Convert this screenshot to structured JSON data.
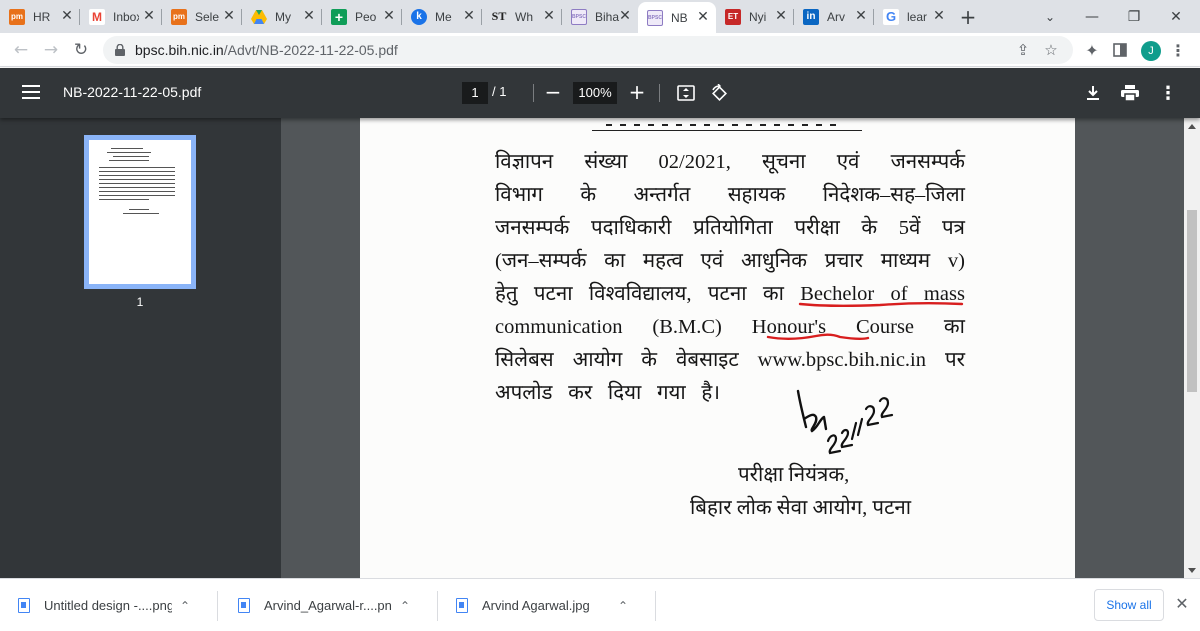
{
  "tabs": [
    {
      "title": "HR",
      "favicon": "pm-icon",
      "favicon_text": "pm",
      "color": "#e8711a"
    },
    {
      "title": "Inbox",
      "favicon": "gmail-icon",
      "favicon_text": "M",
      "color": "#ea4335"
    },
    {
      "title": "Sele",
      "favicon": "pm-icon",
      "favicon_text": "pm",
      "color": "#e8711a"
    },
    {
      "title": "My",
      "favicon": "drive-icon",
      "favicon_text": "▲",
      "color": "#1fa463"
    },
    {
      "title": "Peo",
      "favicon": "sheets-plus-icon",
      "favicon_text": "+",
      "color": "#0f9d58"
    },
    {
      "title": "Me",
      "favicon": "k-icon",
      "favicon_text": "k",
      "color": "#1a73e8"
    },
    {
      "title": "Wh",
      "favicon": "st-icon",
      "favicon_text": "ST",
      "color": "#222222"
    },
    {
      "title": "Biha",
      "favicon": "bpsc-icon",
      "favicon_text": "BPSC",
      "color": "#8e7cc3"
    },
    {
      "title": "NB",
      "favicon": "bpsc-icon",
      "favicon_text": "BPSC",
      "color": "#8e7cc3",
      "active": true
    },
    {
      "title": "Nyi",
      "favicon": "et-icon",
      "favicon_text": "ET",
      "color": "#c62828"
    },
    {
      "title": "Arv",
      "favicon": "linkedin-icon",
      "favicon_text": "in",
      "color": "#0a66c2"
    },
    {
      "title": "lear",
      "favicon": "google-icon",
      "favicon_text": "G",
      "color": "#4285f4"
    }
  ],
  "address_bar": {
    "host": "bpsc.bih.nic.in",
    "path": "/Advt/NB-2022-11-22-05.pdf"
  },
  "pdf_toolbar": {
    "file_name": "NB-2022-11-22-05.pdf",
    "current_page": "1",
    "total_pages": "/ 1",
    "zoom": "100%"
  },
  "sidebar": {
    "thumbnail_label": "1"
  },
  "document": {
    "lines": [
      [
        "विज्ञापन",
        "संख्या",
        "02/2021,",
        "सूचना",
        "एवं",
        "जनसम्पर्क"
      ],
      [
        "विभाग",
        "के",
        "अन्तर्गत",
        "सहायक",
        "निदेशक–सह–जिला"
      ],
      [
        "जनसम्पर्क",
        "पदाधिकारी",
        "प्रतियोगिता",
        "परीक्षा",
        "के",
        "5वें",
        "पत्र"
      ],
      [
        "(जन–सम्पर्क",
        "का",
        "महत्व",
        "एवं",
        "आधुनिक",
        "प्रचार",
        "माध्यम",
        "v)"
      ],
      [
        "हेतु",
        "पटना",
        "विश्वविद्यालय,",
        "पटना",
        "का",
        "Bechelor",
        "of",
        "mass"
      ],
      [
        "communication",
        "(B.M.C)",
        "Honour's",
        "Course",
        "का"
      ],
      [
        "सिलेबस",
        "आयोग",
        "के",
        "वेबसाइट",
        "www.bpsc.bih.nic.in",
        "पर"
      ],
      [
        "अपलोड",
        "कर",
        "दिया",
        "गया",
        "है।"
      ]
    ],
    "signature_date": "22/11/22",
    "signatory_title": "परीक्षा नियंत्रक,",
    "signatory_org": "बिहार लोक सेवा आयोग, पटना"
  },
  "downloads": [
    {
      "name": "Untitled design -....png"
    },
    {
      "name": "Arvind_Agarwal-r....png"
    },
    {
      "name": "Arvind Agarwal.jpg"
    }
  ],
  "downloads_bar": {
    "show_all_label": "Show all"
  },
  "profile": {
    "initial": "J"
  }
}
